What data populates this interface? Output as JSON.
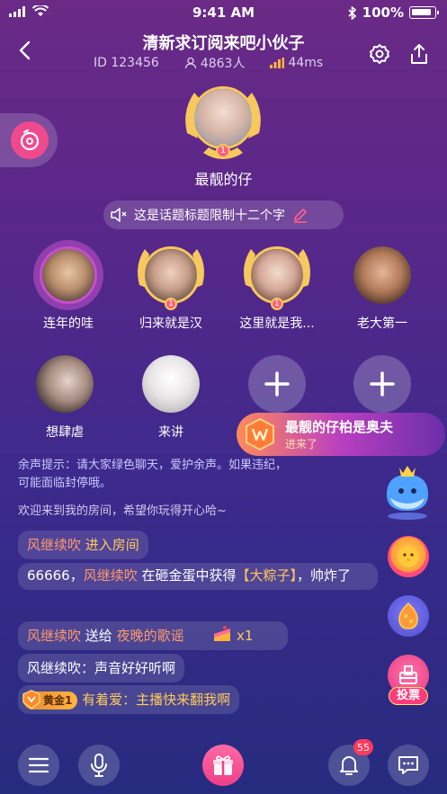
{
  "status": {
    "time": "9:41 AM",
    "battery": "100%"
  },
  "header": {
    "title": "清新求订阅来吧小伙子",
    "room_id": "ID 123456",
    "members": "4863人",
    "latency": "44ms"
  },
  "host": {
    "name": "最靓的仔",
    "rank": "1"
  },
  "topic": {
    "text": "这是话题标题限制十二个字"
  },
  "seats": [
    {
      "name": "连年的哇",
      "rank": ""
    },
    {
      "name": "归来就是汉",
      "rank": "1"
    },
    {
      "name": "这里就是我...",
      "rank": "1"
    },
    {
      "name": "老大第一",
      "rank": ""
    },
    {
      "name": "想肆虐",
      "rank": ""
    },
    {
      "name": "来讲",
      "rank": ""
    }
  ],
  "banner": {
    "line1": "最靓的仔柏是奥夫",
    "line2": "进来了"
  },
  "chat": {
    "notice": "余声提示：请大家绿色聊天，爱护余声。如果违纪，可能面临封停哦。",
    "welcome": "欢迎来到我的房间，希望你玩得开心哈~",
    "m1": {
      "user": "风继续吹",
      "action": "进入房间"
    },
    "m2": {
      "prefix": "66666，",
      "user": "风继续吹",
      "mid": "在砸金蛋中获得",
      "prize": "【大粽子】",
      "suffix": "，帅炸了"
    },
    "m3": {
      "user": "风继续吹",
      "action": "送给",
      "target": "夜晚的歌谣",
      "count": "x1"
    },
    "m4": {
      "text": "风继续吹：声音好好听啊"
    },
    "m5": {
      "badge": "黄金1",
      "user": "有着爱",
      "text": "：主播快来翻我啊"
    }
  },
  "side": {
    "vote_label": "投票"
  },
  "bottom": {
    "notif_count": "55"
  },
  "colors": {
    "accent": "#ef4a8e",
    "chat_name": "#ff9a6b",
    "gift": "#ffc95a"
  }
}
